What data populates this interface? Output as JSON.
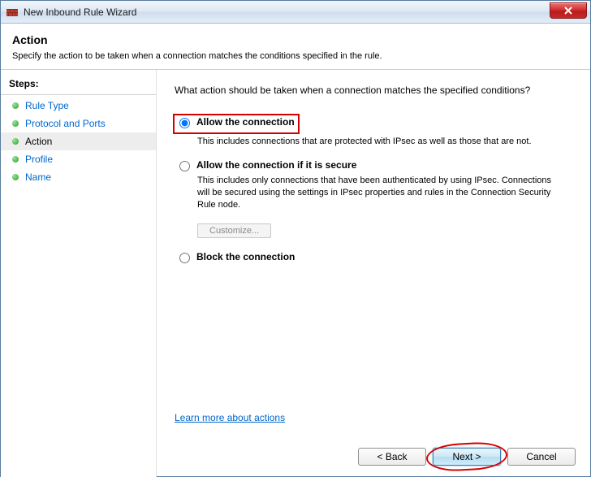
{
  "window": {
    "title": "New Inbound Rule Wizard"
  },
  "header": {
    "title": "Action",
    "subtitle": "Specify the action to be taken when a connection matches the conditions specified in the rule."
  },
  "sidebar": {
    "heading": "Steps:",
    "items": [
      {
        "label": "Rule Type",
        "active": false
      },
      {
        "label": "Protocol and Ports",
        "active": false
      },
      {
        "label": "Action",
        "active": true
      },
      {
        "label": "Profile",
        "active": false
      },
      {
        "label": "Name",
        "active": false
      }
    ]
  },
  "main": {
    "question": "What action should be taken when a connection matches the specified conditions?",
    "options": {
      "allow": {
        "label": "Allow the connection",
        "desc": "This includes connections that are protected with IPsec as well as those that are not."
      },
      "allow_secure": {
        "label": "Allow the connection if it is secure",
        "desc": "This includes only connections that have been authenticated by using IPsec.  Connections will be secured using the settings in IPsec properties and rules in the Connection Security Rule node."
      },
      "block": {
        "label": "Block the connection"
      }
    },
    "customize_label": "Customize...",
    "learn_link": "Learn more about actions"
  },
  "buttons": {
    "back": "< Back",
    "next": "Next >",
    "cancel": "Cancel"
  }
}
